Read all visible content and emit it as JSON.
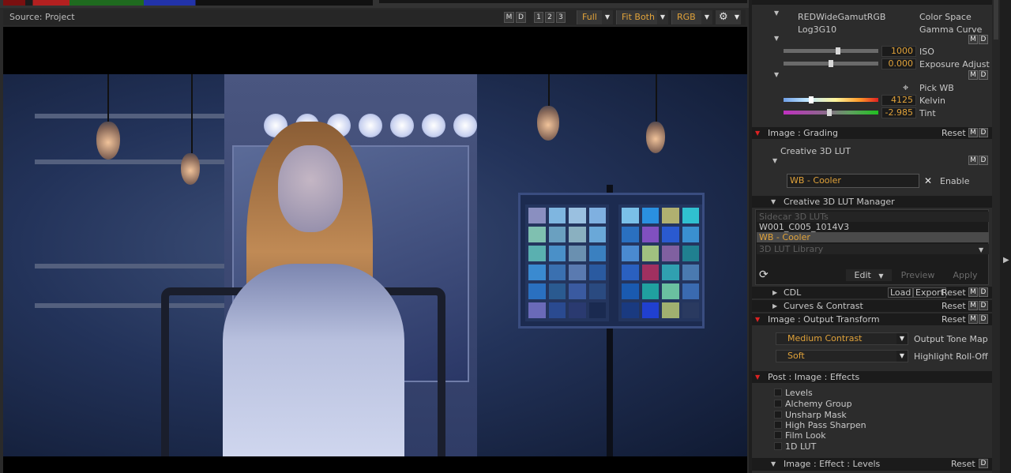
{
  "viewer": {
    "source_label": "Source: Project",
    "buttons": {
      "m": "M",
      "d": "D",
      "b1": "1",
      "b2": "2",
      "b3": "3"
    },
    "dropdowns": {
      "full": "Full",
      "fit": "Fit Both",
      "rgb": "RGB"
    },
    "gear": "⚙",
    "caret": "▼"
  },
  "panel": {
    "color_space_value": "REDWideGamutRGB",
    "color_space_label": "Color Space",
    "gamma_value": "Log3G10",
    "gamma_label": "Gamma Curve",
    "m": "M",
    "d": "D",
    "iso_value": "1000",
    "iso_label": "ISO",
    "exposure_value": "0.000",
    "exposure_label": "Exposure Adjust",
    "pick_wb_label": "Pick WB",
    "kelvin_value": "4125",
    "kelvin_label": "Kelvin",
    "tint_value": "-2.985",
    "tint_label": "Tint",
    "grading_title": "Image : Grading",
    "reset": "Reset",
    "creative_lut_label": "Creative 3D LUT",
    "lut_value": "WB - Cooler",
    "close": "✕",
    "enable_label": "Enable",
    "lut_manager_title": "Creative 3D LUT Manager",
    "lut_list": [
      {
        "label": "Sidecar 3D LUTs",
        "kind": "hdr"
      },
      {
        "label": "W001_C005_1014V3",
        "kind": "item"
      },
      {
        "label": "WB - Cooler",
        "kind": "sel"
      },
      {
        "label": "3D LUT Library",
        "kind": "hdr"
      }
    ],
    "refresh": "⟳",
    "edit": "Edit",
    "preview": "Preview",
    "apply": "Apply",
    "cdl_title": "CDL",
    "load": "Load",
    "export": "Export",
    "curves_title": "Curves & Contrast",
    "output_title": "Image : Output Transform",
    "tone_map_value": "Medium Contrast",
    "tone_map_label": "Output Tone Map",
    "rolloff_value": "Soft",
    "rolloff_label": "Highlight Roll-Off",
    "effects_title": "Post : Image : Effects",
    "effects": [
      "Levels",
      "Alchemy Group",
      "Unsharp Mask",
      "High Pass Sharpen",
      "Film Look",
      "1D LUT"
    ],
    "levels_title": "Image : Effect : Levels"
  },
  "colors": {
    "accent": "#e0a23a",
    "section_arrow": "#dd2222"
  }
}
